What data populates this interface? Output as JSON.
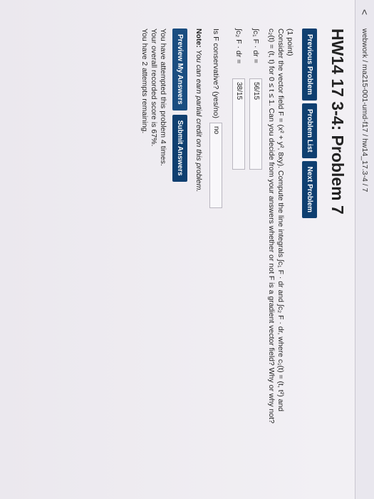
{
  "header": {
    "back_glyph": "<",
    "breadcrumb": "webwork / ma215-001-umd-f17 / hw14_17.3-4 / 7"
  },
  "title": "HW14 17 3-4: Problem 7",
  "nav": {
    "previous": "Previous Problem",
    "list": "Problem List",
    "next": "Next Problem"
  },
  "problem": {
    "points": "(1 point)",
    "text1": "Consider the vector field F = (x² + y², 8xy). Compute the line integrals ∫c₁ F · dr and ∫c₂ F · dr, where c₁(t) = (t, t²) and",
    "text2": "c₂(t) = (t, t) for 0 ≤ t ≤ 1. Can you decide from your answers whether or not F is a gradient vector field? Why or why not?",
    "answer1_label": "∫c₁ F · dr =",
    "answer1_value": "56/15",
    "answer2_label": "∫c₂ F · dr =",
    "answer2_value": "38/15",
    "answer3_label": "Is F conservative? (yes/no)",
    "answer3_value": "no"
  },
  "note": {
    "label": "Note:",
    "text": "You can earn partial credit on this problem."
  },
  "actions": {
    "preview": "Preview My Answers",
    "submit": "Submit Answers"
  },
  "status": {
    "attempted": "You have attempted this problem 4 times.",
    "score": "Your overall recorded score is 67%.",
    "remaining": "You have 2 attempts remaining."
  }
}
